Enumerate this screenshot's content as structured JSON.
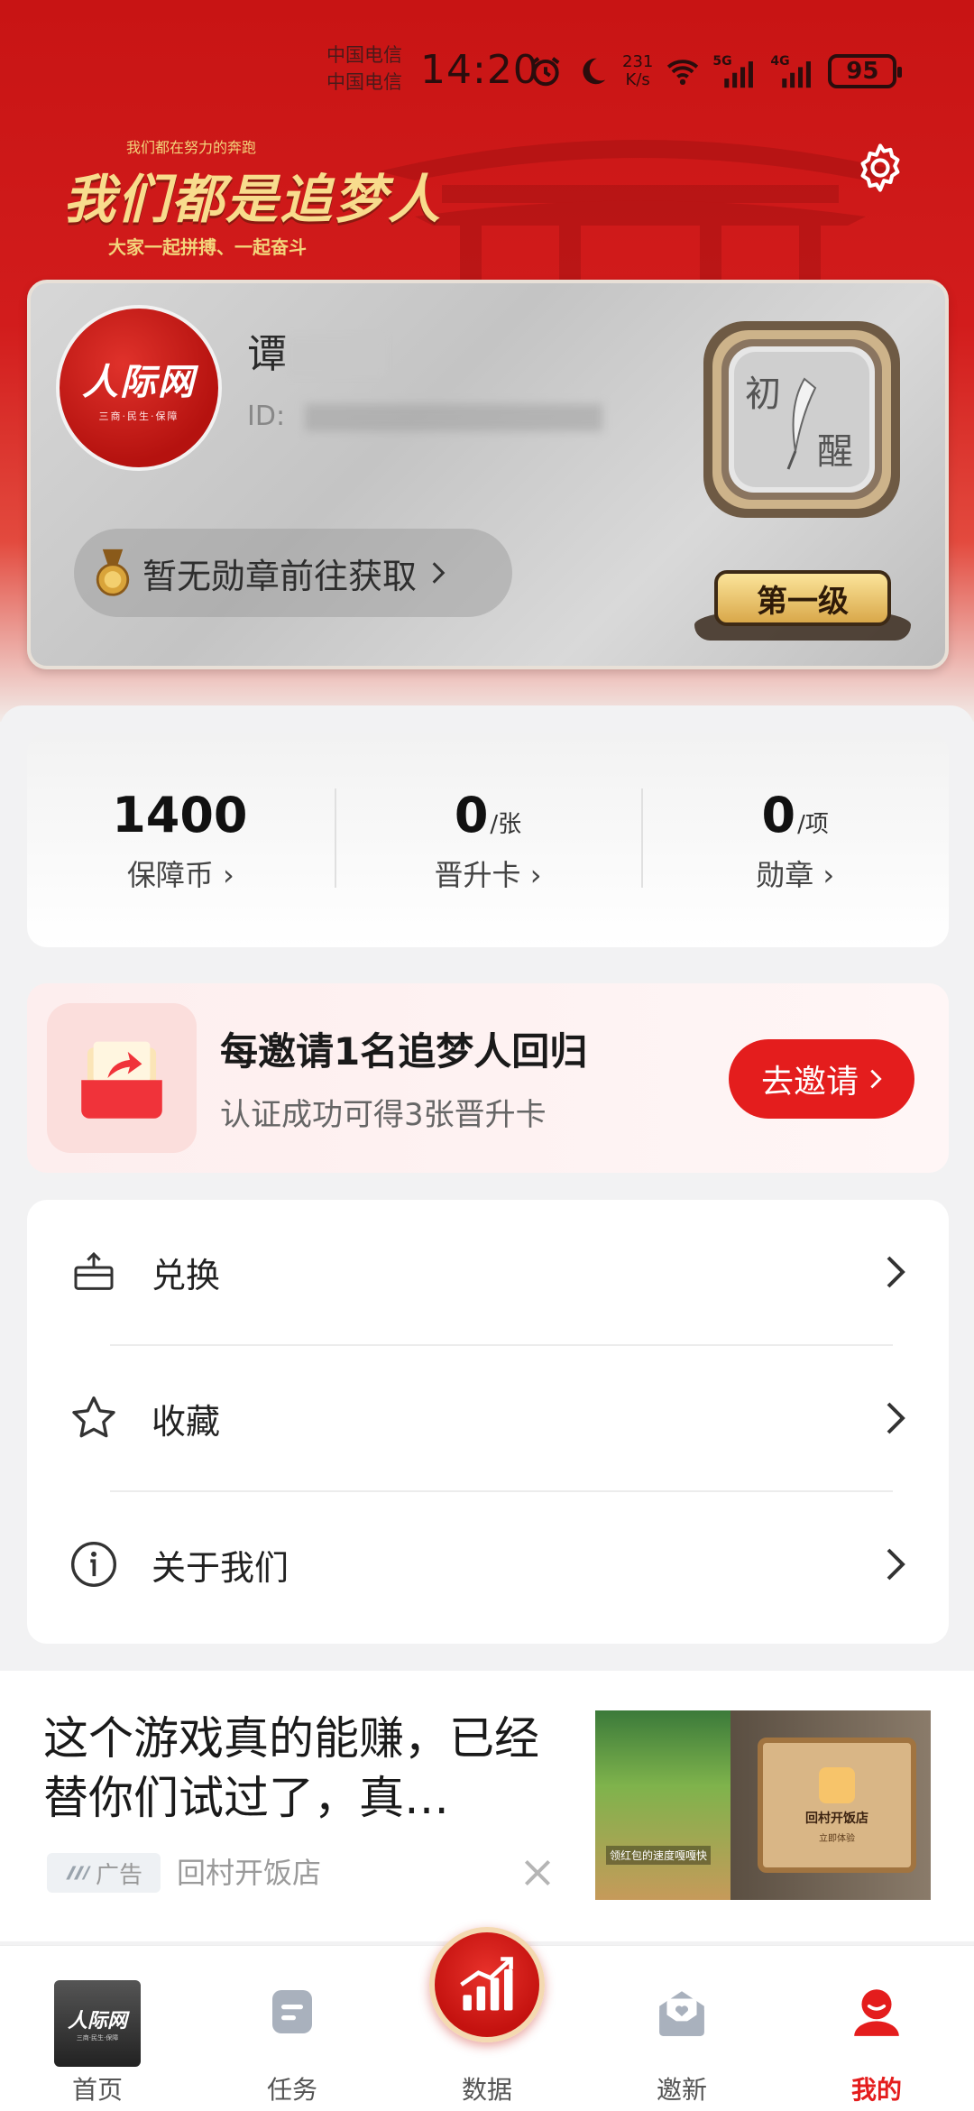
{
  "status_bar": {
    "carrier_1": "中国电信",
    "carrier_2": "中国电信",
    "time": "14:20",
    "net_speed_value": "231",
    "net_speed_unit": "K/s",
    "signal_1": "5G",
    "signal_2": "4G",
    "battery": "95"
  },
  "header": {
    "slogan_small": "我们都在努力的奔跑",
    "slogan_main": "我们都是追梦人",
    "slogan_sub": "大家一起拼搏、一起奋斗",
    "settings_icon": "gear-icon"
  },
  "profile": {
    "avatar_logo": "人际网",
    "avatar_sub": "三商·民生·保障",
    "name_visible": "谭",
    "id_prefix": "ID: ",
    "medal_text": "暂无勋章前往获取",
    "level_char_1": "初",
    "level_char_2": "醒",
    "level_tag": "第一级"
  },
  "stats": [
    {
      "value": "1400",
      "unit": "",
      "label": "保障币"
    },
    {
      "value": "0",
      "unit": "/张",
      "label": "晋升卡"
    },
    {
      "value": "0",
      "unit": "/项",
      "label": "勋章"
    }
  ],
  "invite": {
    "title": "每邀请1名追梦人回归",
    "subtitle": "认证成功可得3张晋升卡",
    "button": "去邀请"
  },
  "menu": [
    {
      "label": "兑换",
      "icon": "exchange-icon"
    },
    {
      "label": "收藏",
      "icon": "star-icon"
    },
    {
      "label": "关于我们",
      "icon": "info-icon"
    }
  ],
  "ad": {
    "title": "这个游戏真的能赚，已经替你们试过了，真…",
    "badge": "广告",
    "advertiser": "回村开饭店",
    "image_caption": "领红包的速度嘎嘎快",
    "image_shop_name": "回村开饭店",
    "image_cta": "立即体验"
  },
  "bottom_nav": [
    {
      "label": "首页",
      "icon": "home-thumbnail",
      "active": false
    },
    {
      "label": "任务",
      "icon": "task-icon",
      "active": false
    },
    {
      "label": "数据",
      "icon": "chart-up-icon",
      "active": false
    },
    {
      "label": "邀新",
      "icon": "invite-icon",
      "active": false
    },
    {
      "label": "我的",
      "icon": "profile-icon",
      "active": true
    }
  ],
  "colors": {
    "brand_red": "#e41d1d",
    "header_red": "#c81414",
    "gold": "#f8dc8d"
  }
}
